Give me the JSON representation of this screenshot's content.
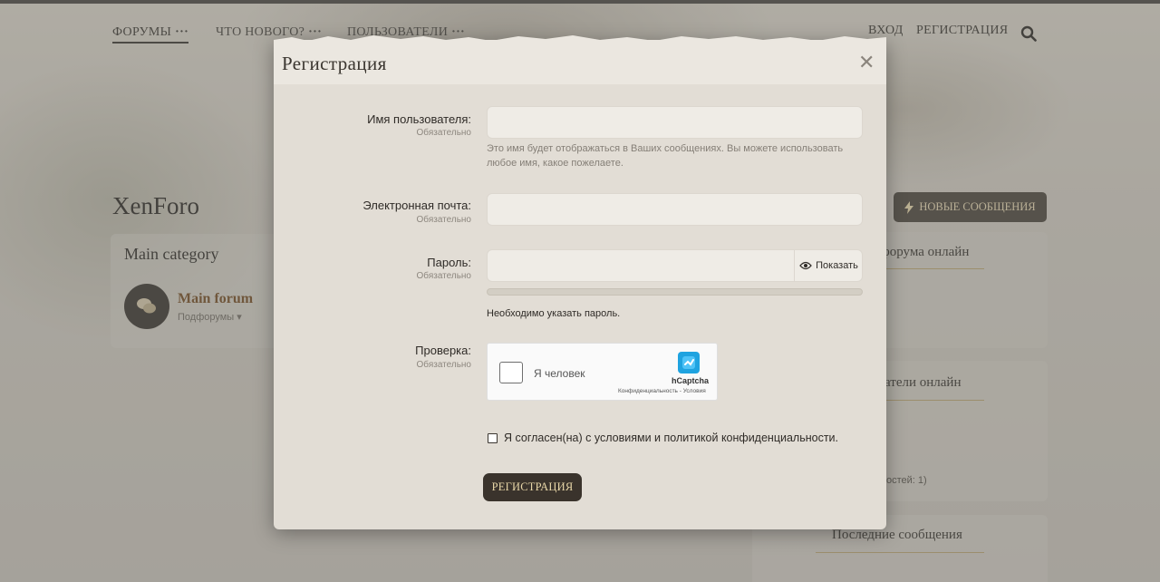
{
  "nav": {
    "items": [
      {
        "label": "Форумы",
        "active": true
      },
      {
        "label": "Что нового?",
        "active": false
      },
      {
        "label": "Пользователи",
        "active": false
      }
    ],
    "login": "Вход",
    "register": "Регистрация"
  },
  "page": {
    "site_title": "XenForo",
    "new_posts": "Новые сообщения",
    "category_title": "Main category",
    "forum_name": "Main forum",
    "forum_sub": "Подфорумы",
    "side": {
      "stats_title": "форума онлайн",
      "users_title": "атели онлайн",
      "guests_fragment": "остей: 1)",
      "latest_title": "Последние сообщения"
    }
  },
  "modal": {
    "title": "Регистрация",
    "username": {
      "label": "Имя пользователя:",
      "required": "Обязательно",
      "value": "",
      "hint": "Это имя будет отображаться в Ваших сообщениях. Вы можете использовать любое имя, какое пожелаете."
    },
    "email": {
      "label": "Электронная почта:",
      "required": "Обязательно",
      "value": ""
    },
    "password": {
      "label": "Пароль:",
      "required": "Обязательно",
      "value": "",
      "show_label": "Показать",
      "strength": 0,
      "message": "Необходимо указать пароль."
    },
    "verification": {
      "label": "Проверка:",
      "required": "Обязательно",
      "captcha_text": "Я человек",
      "captcha_brand": "hCaptcha",
      "captcha_links": "Конфиденциальность - Условия"
    },
    "agree_text": "Я согласен(на) с условиями и политикой конфиденциальности.",
    "submit": "Регистрация"
  },
  "colors": {
    "accent_dark": "#3a332c",
    "accent_gold": "#e8d7a8",
    "forum_link": "#6b4115"
  }
}
